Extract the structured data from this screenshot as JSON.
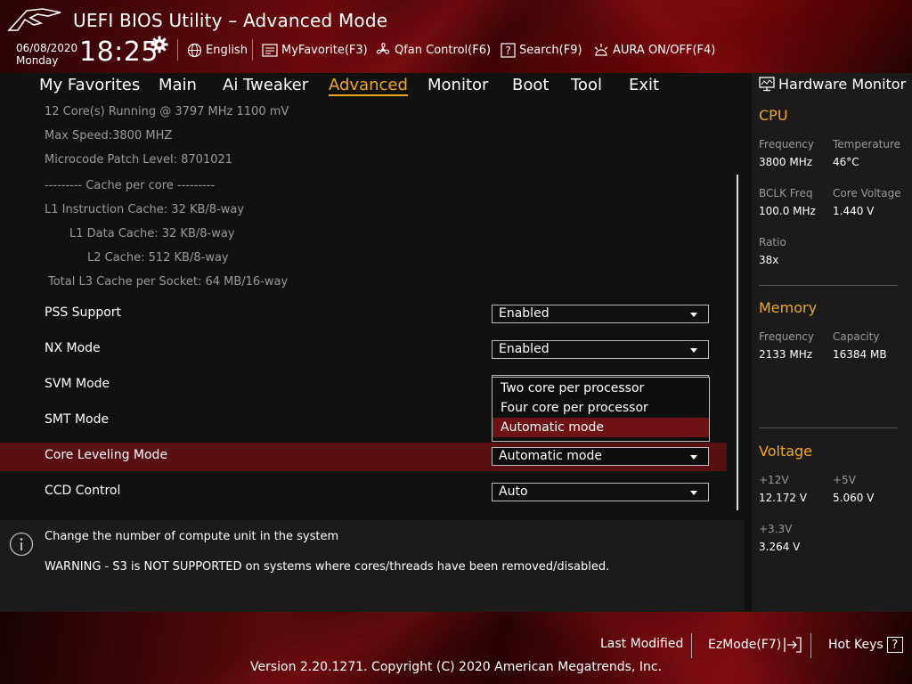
{
  "header": {
    "title": "UEFI BIOS Utility – Advanced Mode",
    "date": "06/08/2020",
    "day": "Monday",
    "time": "18:25",
    "language": "English",
    "myfavorite": "MyFavorite(F3)",
    "qfan": "Qfan Control(F6)",
    "search": "Search(F9)",
    "aura": "AURA ON/OFF(F4)"
  },
  "menu": {
    "items": [
      "My Favorites",
      "Main",
      "Ai Tweaker",
      "Advanced",
      "Monitor",
      "Boot",
      "Tool",
      "Exit"
    ],
    "active": "Advanced",
    "accent_color": "#f0a91c"
  },
  "info": {
    "cores": "12 Core(s) Running @ 3797 MHz  1100 mV",
    "max_speed": "Max Speed:3800 MHZ",
    "microcode": "Microcode Patch Level: 8701021",
    "cache_header": "--------- Cache per core ---------",
    "l1i": "L1 Instruction Cache: 32 KB/8-way",
    "l1d": "L1 Data Cache: 32 KB/8-way",
    "l2": "L2 Cache: 512 KB/8-way",
    "l3": "Total L3 Cache per Socket: 64 MB/16-way"
  },
  "settings": {
    "pss": {
      "label": "PSS Support",
      "value": "Enabled"
    },
    "nx": {
      "label": "NX Mode",
      "value": "Enabled"
    },
    "svm": {
      "label": "SVM Mode"
    },
    "smt": {
      "label": "SMT Mode"
    },
    "core_leveling": {
      "label": "Core Leveling Mode",
      "value": "Automatic mode"
    },
    "ccd": {
      "label": "CCD Control",
      "value": "Auto"
    }
  },
  "dropdown": {
    "options": [
      "Two core per processor",
      "Four core per processor",
      "Automatic mode"
    ],
    "selected": "Automatic mode"
  },
  "help": {
    "line1": "Change the number of compute unit in the system",
    "line2": "WARNING - S3 is NOT SUPPORTED on systems where cores/threads have been removed/disabled."
  },
  "hw": {
    "title": "Hardware Monitor",
    "cpu": {
      "section": "CPU",
      "frequency_label": "Frequency",
      "frequency": "3800 MHz",
      "temperature_label": "Temperature",
      "temperature": "46°C",
      "bclk_label": "BCLK Freq",
      "bclk": "100.0 MHz",
      "core_voltage_label": "Core Voltage",
      "core_voltage": "1.440 V",
      "ratio_label": "Ratio",
      "ratio": "38x"
    },
    "memory": {
      "section": "Memory",
      "frequency_label": "Frequency",
      "frequency": "2133 MHz",
      "capacity_label": "Capacity",
      "capacity": "16384 MB"
    },
    "voltage": {
      "section": "Voltage",
      "v12_label": "+12V",
      "v12": "12.172 V",
      "v5_label": "+5V",
      "v5": "5.060 V",
      "v33_label": "+3.3V",
      "v33": "3.264 V"
    }
  },
  "footer": {
    "last_modified": "Last Modified",
    "ezmode": "EzMode(F7)",
    "hotkeys": "Hot Keys",
    "hotkeys_key": "?",
    "copyright": "Version 2.20.1271. Copyright (C) 2020 American Megatrends, Inc."
  }
}
